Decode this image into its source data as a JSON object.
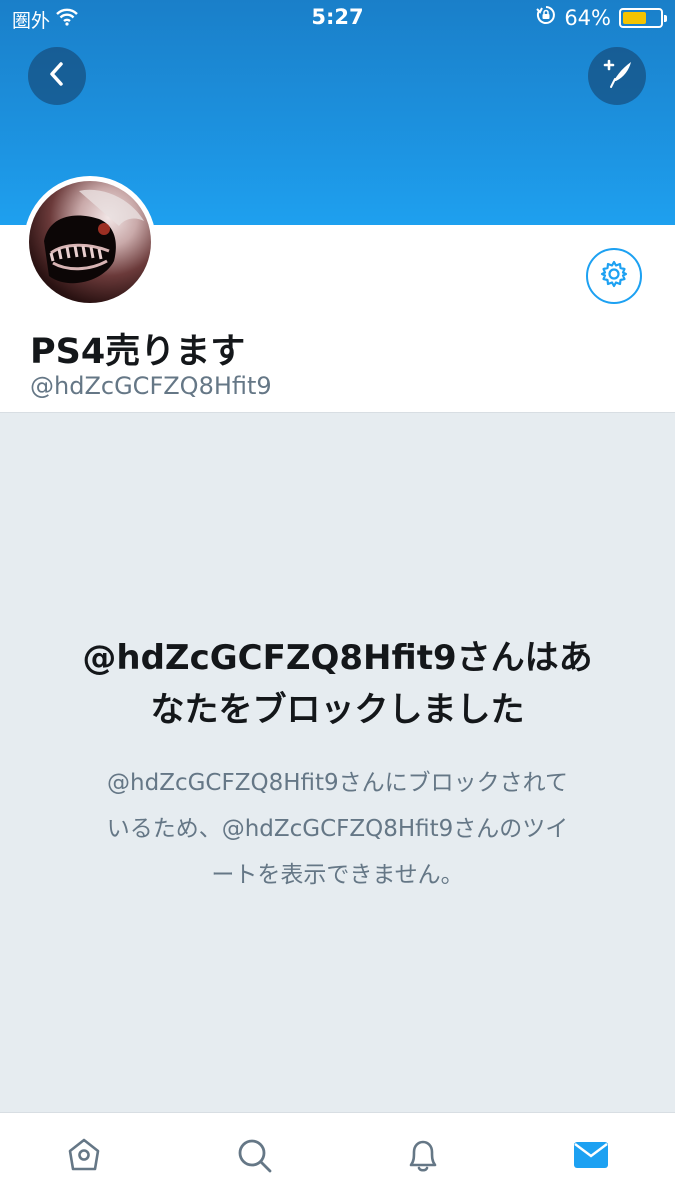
{
  "status_bar": {
    "carrier": "圏外",
    "time": "5:27",
    "battery_percent": "64%",
    "battery_level": 0.64,
    "icons": [
      "wifi-icon",
      "rotation-lock-icon",
      "battery-icon"
    ]
  },
  "header": {
    "back_icon": "chevron-left-icon",
    "compose_icon": "compose-tweet-icon",
    "color": "#1da1f2"
  },
  "profile": {
    "display_name": "PS4売ります",
    "handle": "@hdZcGCFZQ8Hfit9",
    "settings_icon": "gear-icon"
  },
  "blocked_notice": {
    "title_line1": "@hdZcGCFZQ8Hfit9さんはあ",
    "title_line2": "なたをブロックしました",
    "body_line1": "@hdZcGCFZQ8Hfit9さんにブロックされて",
    "body_line2": "いるため、@hdZcGCFZQ8Hfit9さんのツイ",
    "body_line3": "ートを表示できません。"
  },
  "tab_bar": {
    "tabs": [
      {
        "icon": "home-icon",
        "active": false
      },
      {
        "icon": "search-icon",
        "active": false
      },
      {
        "icon": "notifications-icon",
        "active": false
      },
      {
        "icon": "messages-icon",
        "active": true
      }
    ],
    "active_color": "#1da1f2",
    "inactive_color": "#657786"
  }
}
